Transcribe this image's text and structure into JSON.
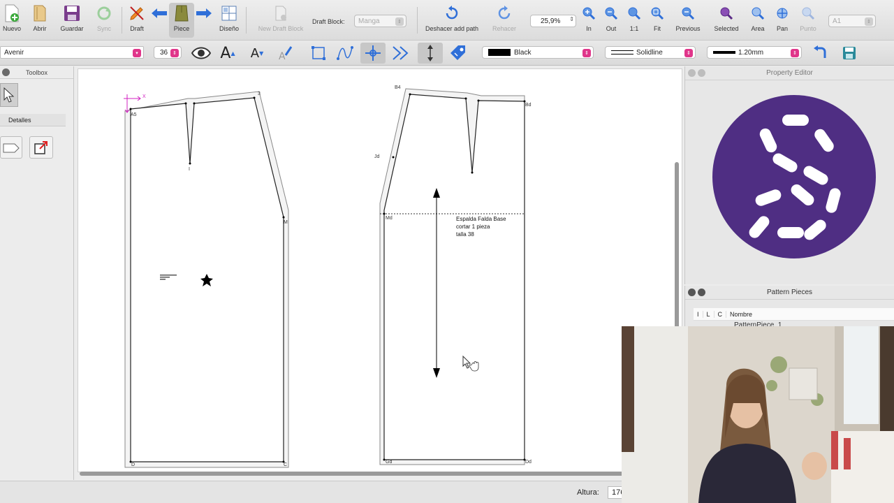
{
  "toolbar": {
    "nuevo": "Nuevo",
    "abrir": "Abrir",
    "guardar": "Guardar",
    "sync": "Sync",
    "draft": "Draft",
    "piece": "Piece",
    "diseno": "Diseño",
    "new_draft_block": "New Draft Block",
    "draft_block_label": "Draft Block:",
    "draft_block_value": "Manga",
    "deshacer": "Deshacer add path",
    "rehacer": "Rehacer",
    "zoom_value": "25,9%",
    "zoom_in": "In",
    "zoom_out": "Out",
    "zoom_1_1": "1:1",
    "zoom_fit": "Fit",
    "previous": "Previous",
    "selected": "Selected",
    "area": "Area",
    "pan": "Pan",
    "punto": "Punto",
    "paper_size": "A1"
  },
  "toolbar2": {
    "font": "Avenir",
    "font_size": "36",
    "line_color": "Black",
    "line_style": "Solidline",
    "line_weight": "1.20mm"
  },
  "toolbox": {
    "title": "Toolbox",
    "detalles": "Detalles"
  },
  "canvas": {
    "front_labels": [
      "A5",
      "3",
      "I",
      "M",
      "D",
      "C",
      "X"
    ],
    "back_labels": [
      "B4",
      "Bd",
      "Jd",
      "Md",
      "Gd",
      "Dd"
    ],
    "back_piece_text": [
      "Espalda Falda Base",
      "cortar 1 pieza",
      "talla 38"
    ]
  },
  "property_editor": {
    "title": "Property Editor"
  },
  "pattern_pieces": {
    "title": "Pattern Pieces",
    "columns": [
      "I",
      "L",
      "C",
      "Nombre"
    ],
    "rows": [
      "PatternPiece_1"
    ]
  },
  "statusbar": {
    "altura_label": "Altura:",
    "altura_value": "176"
  },
  "colors": {
    "accent_pink": "#e0358a",
    "logo_purple": "#4f2e83",
    "zoom_blue": "#3b7fd6"
  }
}
